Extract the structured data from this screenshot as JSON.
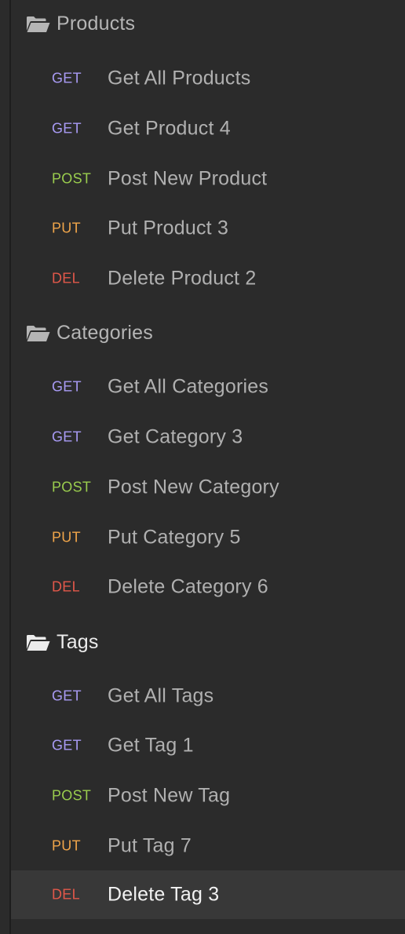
{
  "groups": [
    {
      "name": "Products",
      "icon": "folder-open-icon",
      "requests": [
        {
          "method": "GET",
          "name": "Get All Products"
        },
        {
          "method": "GET",
          "name": "Get Product 4"
        },
        {
          "method": "POST",
          "name": "Post New Product"
        },
        {
          "method": "PUT",
          "name": "Put Product 3"
        },
        {
          "method": "DEL",
          "name": "Delete Product 2"
        }
      ]
    },
    {
      "name": "Categories",
      "icon": "folder-open-icon",
      "requests": [
        {
          "method": "GET",
          "name": "Get All Categories"
        },
        {
          "method": "GET",
          "name": "Get Category 3"
        },
        {
          "method": "POST",
          "name": "Post New Category"
        },
        {
          "method": "PUT",
          "name": "Put Category 5"
        },
        {
          "method": "DEL",
          "name": "Delete Category 6"
        }
      ]
    },
    {
      "name": "Tags",
      "icon": "folder-open-icon",
      "requests": [
        {
          "method": "GET",
          "name": "Get All Tags"
        },
        {
          "method": "GET",
          "name": "Get Tag 1"
        },
        {
          "method": "POST",
          "name": "Post New Tag"
        },
        {
          "method": "PUT",
          "name": "Put Tag 7"
        },
        {
          "method": "DEL",
          "name": "Delete Tag 3"
        }
      ]
    }
  ],
  "selected_request": "Delete Tag 3",
  "colors": {
    "background": "#2b2b2b",
    "selected_row": "#383838",
    "get": "#a99bf5",
    "post": "#9acd4e",
    "put": "#f0a54a",
    "del": "#e2584a"
  }
}
